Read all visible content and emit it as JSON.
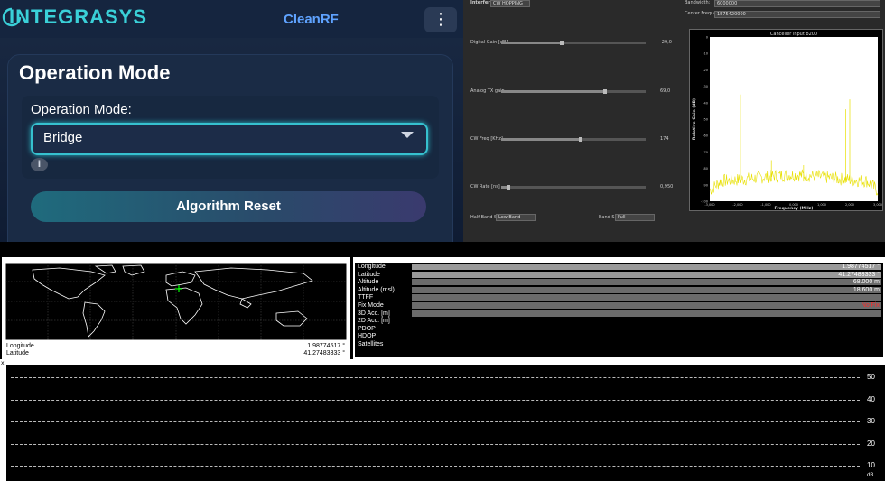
{
  "app": {
    "logo_text": "INTEGRASYS",
    "title": "CleanRF",
    "menu_icon": "vertical-dots-icon",
    "card_title": "Operation Mode",
    "mode_label": "Operation Mode:",
    "mode_value": "Bridge",
    "info_glyph": "i",
    "reset_label": "Algorithm Reset"
  },
  "canceller": {
    "interferer_label": "Interferer:",
    "interferer_value": "CW HOPPING",
    "bandwidth_label": "Bandwidth:",
    "bandwidth_value": "6000000",
    "center_freq_label": "Center Frequency:",
    "center_freq_value": "1575420000",
    "sliders": [
      {
        "label": "Digital Gain [dB]",
        "value": "-29,0",
        "level": 0.42
      },
      {
        "label": "Analog TX gain",
        "value": "69,0",
        "level": 0.72
      },
      {
        "label": "CW Freq [KHz]",
        "value": "174",
        "level": 0.55
      },
      {
        "label": "CW Rate [ns]",
        "value": "0,950",
        "level": 0.05
      }
    ],
    "half_band_label": "Half Band Sel:",
    "half_band_value": "Low Band",
    "band_sel_label": "Band Sel:",
    "band_sel_value": "Full"
  },
  "chart_data": {
    "type": "line",
    "title": "Canceller input b200",
    "xlabel": "Frequency (MHz)",
    "ylabel": "Relative Gain (dB)",
    "xlim": [
      -3.0,
      3.0
    ],
    "ylim": [
      -100,
      0
    ],
    "x_ticks": [
      "-3,000",
      "-2,000",
      "-1,000",
      "0,000",
      "1,000",
      "2,000",
      "3,000"
    ],
    "y_ticks": [
      "0",
      "-10",
      "-20",
      "-30",
      "-40",
      "-50",
      "-60",
      "-70",
      "-80",
      "-90",
      "-100"
    ],
    "noise_floor": -88,
    "peaks": [
      {
        "x": -1.9,
        "y": -35
      },
      {
        "x": -0.8,
        "y": -75
      },
      {
        "x": 0.35,
        "y": -78
      },
      {
        "x": 1.85,
        "y": -44
      },
      {
        "x": 2.0,
        "y": -38
      }
    ],
    "series_color": "#e8e000"
  },
  "map": {
    "marker_color": "#00ff00",
    "longitude_label": "Longitude",
    "longitude_value": "1.98774517 °",
    "latitude_label": "Latitude",
    "latitude_value": "41.27483333 °"
  },
  "gps_info": [
    {
      "key": "Longitude",
      "value": "1.98774517 °"
    },
    {
      "key": "Latitude",
      "value": "41.27483333 °"
    },
    {
      "key": "Altitude",
      "value": "68.000 m"
    },
    {
      "key": "Altitude (msl)",
      "value": "18.600 m"
    },
    {
      "key": "TTFF",
      "value": ""
    },
    {
      "key": "Fix Mode",
      "value": "No Fix",
      "color": "#ff2a2a"
    },
    {
      "key": "3D Acc. [m]",
      "value": ""
    },
    {
      "key": "2D Acc. [m]",
      "value": ""
    },
    {
      "key": "PDOP",
      "value": ""
    },
    {
      "key": "HDOP",
      "value": ""
    },
    {
      "key": "Satellites",
      "value": ""
    }
  ],
  "strip_chart": {
    "y_ticks": [
      "50",
      "40",
      "30",
      "20",
      "10"
    ],
    "unit": "dB",
    "close_glyph": "x"
  }
}
